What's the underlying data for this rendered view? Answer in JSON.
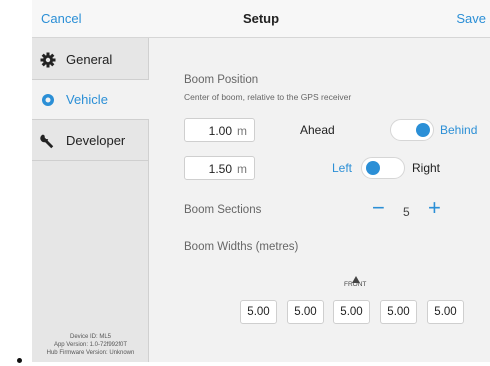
{
  "navbar": {
    "cancel_label": "Cancel",
    "title": "Setup",
    "save_label": "Save"
  },
  "sidebar": {
    "items": [
      {
        "label": "General",
        "icon": "gear-icon"
      },
      {
        "label": "Vehicle",
        "icon": "radio-dot-icon",
        "active": true
      },
      {
        "label": "Developer",
        "icon": "wrench-icon"
      }
    ],
    "device_info": {
      "device_id": "Device ID: ML5",
      "app_version": "App Version: 1.0-72f992f0T",
      "hub_firmware": "Hub Firmware Version: Unknown"
    }
  },
  "boom_position": {
    "title": "Boom Position",
    "subtitle": "Center of boom, relative to the GPS receiver",
    "row1": {
      "value": "1.00",
      "unit": "m",
      "left_word": "Ahead",
      "right_word": "Behind",
      "selected": "Behind"
    },
    "row2": {
      "value": "1.50",
      "unit": "m",
      "left_word": "Left",
      "right_word": "Right",
      "selected": "Left"
    }
  },
  "boom_sections": {
    "title": "Boom Sections",
    "minus_label": "−",
    "value": "5",
    "plus_label": "+"
  },
  "boom_widths": {
    "title": "Boom Widths (metres)",
    "front_label": "FRONT",
    "values": [
      "5.00",
      "5.00",
      "5.00",
      "5.00",
      "5.00"
    ]
  },
  "colors": {
    "accent": "#2b8fd6",
    "sidebar_bg": "#e6e6e6",
    "content_bg": "#f2f2f2"
  }
}
